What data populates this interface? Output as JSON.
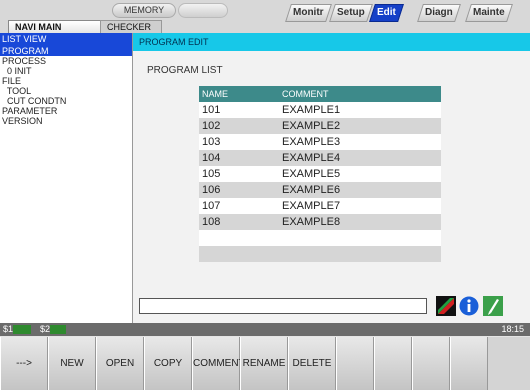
{
  "top": {
    "memory": "MEMORY",
    "modes": [
      {
        "label": "Monitr",
        "active": false
      },
      {
        "label": "Setup",
        "active": false
      },
      {
        "label": "Edit",
        "active": true
      },
      {
        "label": "Diagn",
        "active": false
      },
      {
        "label": "Mainte",
        "active": false
      }
    ],
    "nav_main": "NAVI MAIN",
    "checker": "CHECKER"
  },
  "tree": {
    "header": "LIST VIEW",
    "items": [
      {
        "label": "PROGRAM",
        "selected": true
      },
      {
        "label": "PROCESS",
        "selected": false
      },
      {
        "label": "  0 INIT",
        "selected": false
      },
      {
        "label": "FILE",
        "selected": false
      },
      {
        "label": "  TOOL",
        "selected": false
      },
      {
        "label": "  CUT CONDTN",
        "selected": false
      },
      {
        "label": "PARAMETER",
        "selected": false
      },
      {
        "label": "VERSION",
        "selected": false
      }
    ]
  },
  "content": {
    "header": "PROGRAM EDIT",
    "list_title": "PROGRAM LIST",
    "columns": [
      "NAME",
      "COMMENT"
    ],
    "rows": [
      [
        "101",
        "EXAMPLE1"
      ],
      [
        "102",
        "EXAMPLE2"
      ],
      [
        "103",
        "EXAMPLE3"
      ],
      [
        "104",
        "EXAMPLE4"
      ],
      [
        "105",
        "EXAMPLE5"
      ],
      [
        "106",
        "EXAMPLE6"
      ],
      [
        "107",
        "EXAMPLE7"
      ],
      [
        "108",
        "EXAMPLE8"
      ],
      [
        "",
        ""
      ],
      [
        "",
        ""
      ]
    ],
    "input_value": ""
  },
  "status": {
    "s1": "$1",
    "s2": "$2",
    "time": "18:15"
  },
  "softkeys": [
    "--->",
    "NEW",
    "OPEN",
    "COPY",
    "COMMENT",
    "RENAME",
    "DELETE",
    "",
    "",
    "",
    ""
  ],
  "colors": {
    "accent": "#1848d8",
    "content_header": "#17c8e8",
    "table_header": "#3d8a8a"
  }
}
